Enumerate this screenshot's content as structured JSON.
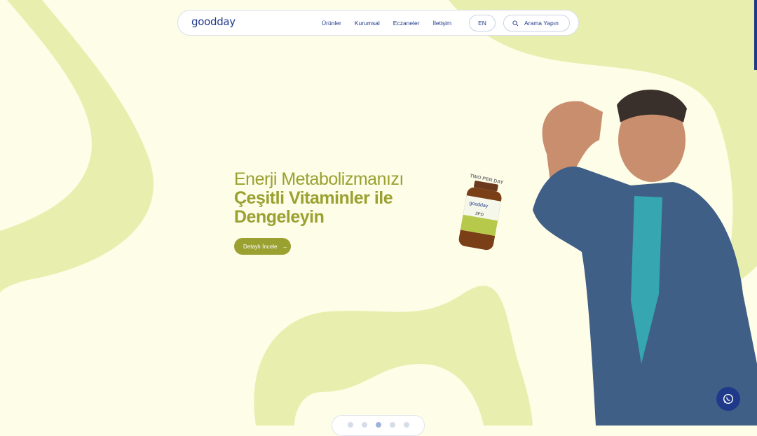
{
  "header": {
    "logo": "goodday",
    "nav": [
      "Ürünler",
      "Kurumsal",
      "Eczaneler",
      "İletişim"
    ],
    "lang": "EN",
    "search_label": "Arama Yapın"
  },
  "hero": {
    "title_line1": "Enerji Metabolizmanızı",
    "title_line2": "Çeşitli Vitaminler ile",
    "title_line3": "Dengeleyin",
    "cta_label": "Detaylı İncele"
  },
  "product": {
    "tag": "TWO PER DAY",
    "label_brand": "goodday",
    "label_name": "2PD"
  },
  "slider": {
    "count": 5,
    "active_index": 2
  },
  "colors": {
    "background": "#fdfde8",
    "accent": "#9aa130",
    "brand": "#1f3a8a",
    "blob": "#e8efae"
  }
}
